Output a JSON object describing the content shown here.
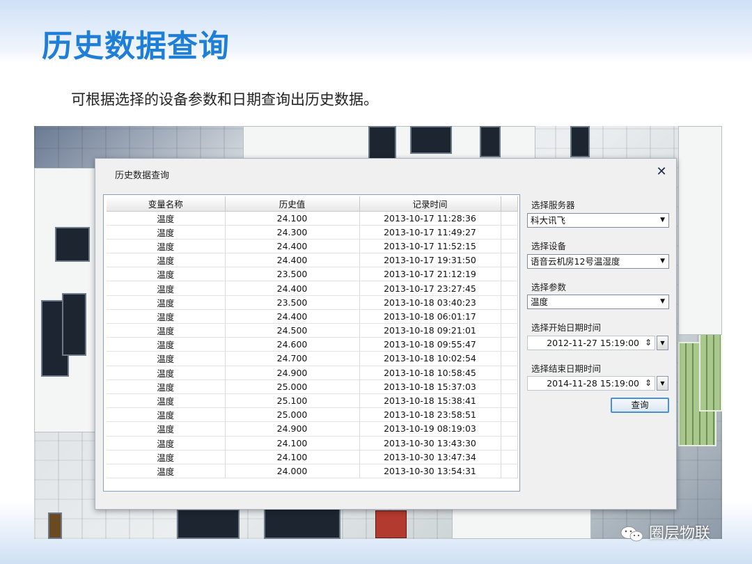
{
  "slide": {
    "title": "历史数据查询",
    "subtitle": "可根据选择的设备参数和日期查询出历史数据。"
  },
  "dialog": {
    "title": "历史数据查询",
    "close_icon": "close-icon",
    "table": {
      "headers": [
        "变量名称",
        "历史值",
        "记录时间"
      ],
      "rows": [
        [
          "温度",
          "24.100",
          "2013-10-17 11:28:36"
        ],
        [
          "温度",
          "24.300",
          "2013-10-17 11:49:27"
        ],
        [
          "温度",
          "24.400",
          "2013-10-17 11:52:15"
        ],
        [
          "温度",
          "24.400",
          "2013-10-17 19:31:50"
        ],
        [
          "温度",
          "23.500",
          "2013-10-17 21:12:19"
        ],
        [
          "温度",
          "24.400",
          "2013-10-17 23:27:45"
        ],
        [
          "温度",
          "23.500",
          "2013-10-18 03:40:23"
        ],
        [
          "温度",
          "24.400",
          "2013-10-18 06:01:17"
        ],
        [
          "温度",
          "24.500",
          "2013-10-18 09:21:01"
        ],
        [
          "温度",
          "24.600",
          "2013-10-18 09:55:47"
        ],
        [
          "温度",
          "24.700",
          "2013-10-18 10:02:54"
        ],
        [
          "温度",
          "24.900",
          "2013-10-18 10:58:45"
        ],
        [
          "温度",
          "25.000",
          "2013-10-18 15:37:03"
        ],
        [
          "温度",
          "25.100",
          "2013-10-18 15:38:41"
        ],
        [
          "温度",
          "25.000",
          "2013-10-18 23:58:51"
        ],
        [
          "温度",
          "24.900",
          "2013-10-19 08:19:03"
        ],
        [
          "温度",
          "24.100",
          "2013-10-30 13:43:30"
        ],
        [
          "温度",
          "24.100",
          "2013-10-30 13:47:34"
        ],
        [
          "温度",
          "24.000",
          "2013-10-30 13:54:31"
        ]
      ]
    },
    "server": {
      "label": "选择服务器",
      "value": "科大讯飞"
    },
    "device": {
      "label": "选择设备",
      "value": "语音云机房12号温湿度"
    },
    "param": {
      "label": "选择参数",
      "value": "温度"
    },
    "start": {
      "label": "选择开始日期时间",
      "value": "2012-11-27 15:19:00"
    },
    "end": {
      "label": "选择结束日期时间",
      "value": "2014-11-28 15:19:00"
    },
    "query_label": "查询"
  },
  "watermark": {
    "text": "圈层物联",
    "icon": "wechat-icon"
  }
}
